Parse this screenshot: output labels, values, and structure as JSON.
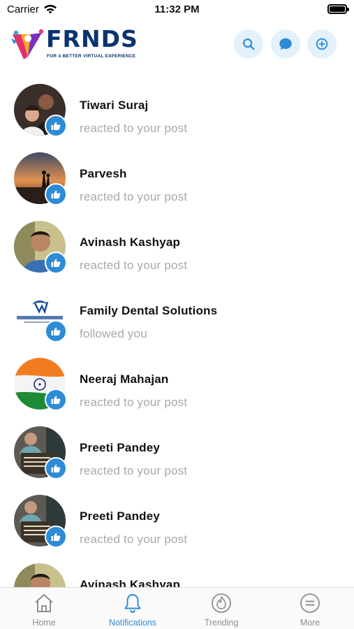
{
  "status_bar": {
    "carrier": "Carrier",
    "time": "11:32 PM"
  },
  "header": {
    "brand": "FRNDS",
    "tagline": "FOR A BETTER VIRTUAL EXPERIENCE",
    "actions": [
      "search-icon",
      "chat-bubble-icon",
      "add-circle-icon"
    ]
  },
  "notifications": [
    {
      "name": "Tiwari Suraj",
      "action": "reacted to your post",
      "reaction": "like-icon"
    },
    {
      "name": "Parvesh",
      "action": "reacted to your post",
      "reaction": "like-icon"
    },
    {
      "name": "Avinash Kashyap",
      "action": "reacted to your post",
      "reaction": "like-icon"
    },
    {
      "name": "Family Dental Solutions",
      "action": "followed you",
      "reaction": "like-icon"
    },
    {
      "name": "Neeraj Mahajan",
      "action": "reacted to your post",
      "reaction": "like-icon"
    },
    {
      "name": "Preeti Pandey",
      "action": "reacted to your post",
      "reaction": "like-icon"
    },
    {
      "name": "Preeti Pandey",
      "action": "reacted to your post",
      "reaction": "like-icon"
    },
    {
      "name": "Avinash Kashyap",
      "action": "",
      "reaction": "like-icon"
    }
  ],
  "tabs": [
    {
      "label": "Home",
      "icon": "home-icon",
      "active": false
    },
    {
      "label": "Notifications",
      "icon": "bell-icon",
      "active": true
    },
    {
      "label": "Trending",
      "icon": "flame-icon",
      "active": false
    },
    {
      "label": "More",
      "icon": "menu-circle-icon",
      "active": false
    }
  ],
  "colors": {
    "accent": "#2e8bd6",
    "brand": "#0a3470",
    "muted": "#a9a9a9",
    "icon_bg": "#e3f1fb"
  }
}
